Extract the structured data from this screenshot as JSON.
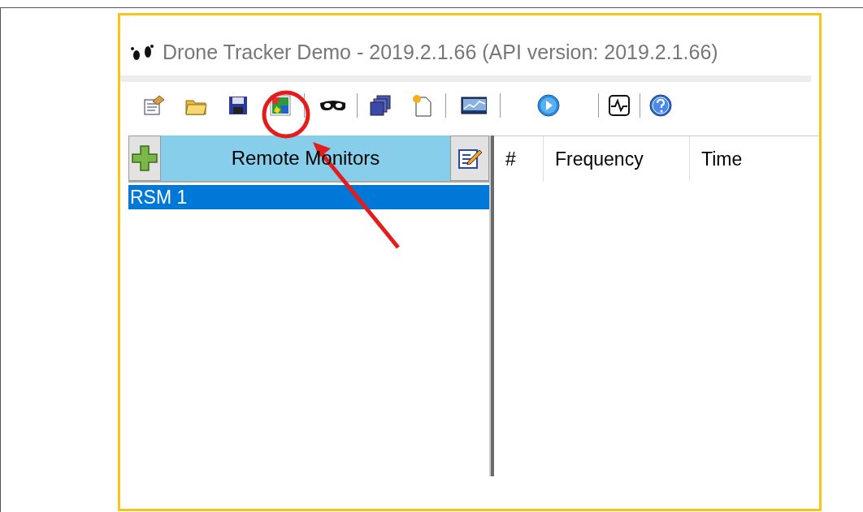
{
  "window": {
    "title": "Drone Tracker Demo - 2019.2.1.66 (API version: 2019.2.1.66)"
  },
  "monitors_panel": {
    "title": "Remote Monitors",
    "items": [
      {
        "label": "RSM 1",
        "selected": true
      }
    ]
  },
  "table": {
    "columns": [
      "#",
      "Frequency",
      "Time"
    ]
  }
}
